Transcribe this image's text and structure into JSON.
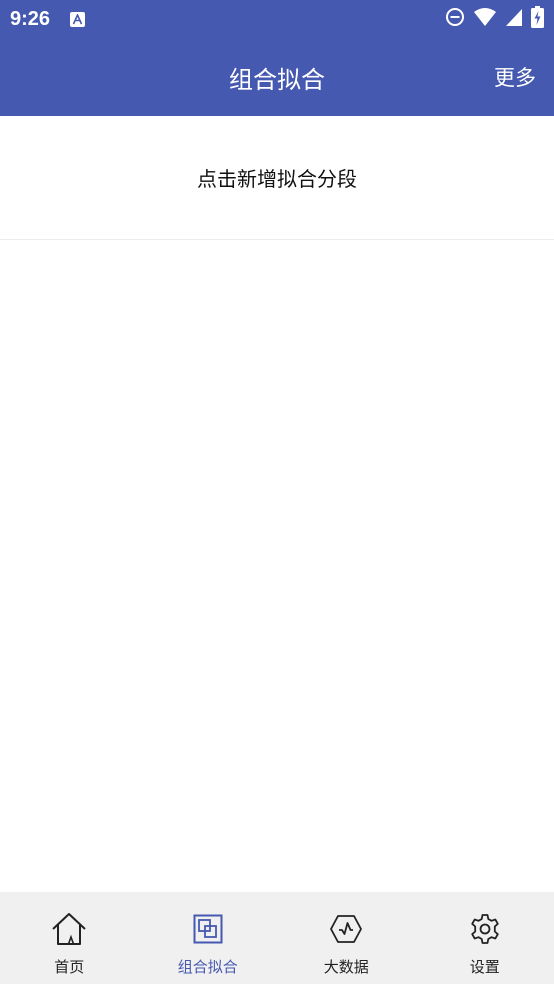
{
  "status_bar": {
    "time": "9:26",
    "icons": [
      "text-a-icon",
      "do-not-disturb-icon",
      "wifi-icon",
      "signal-icon",
      "battery-charging-icon"
    ]
  },
  "app_bar": {
    "title": "组合拟合",
    "more_label": "更多"
  },
  "main": {
    "add_segment_label": "点击新增拟合分段"
  },
  "bottom_nav": {
    "active_index": 1,
    "active_color": "#4659b0",
    "items": [
      {
        "label": "首页",
        "icon": "home-icon"
      },
      {
        "label": "组合拟合",
        "icon": "combine-icon"
      },
      {
        "label": "大数据",
        "icon": "big-data-icon"
      },
      {
        "label": "设置",
        "icon": "gear-icon"
      }
    ]
  },
  "colors": {
    "primary": "#4659b0",
    "nav_background": "#f0f0f0"
  }
}
